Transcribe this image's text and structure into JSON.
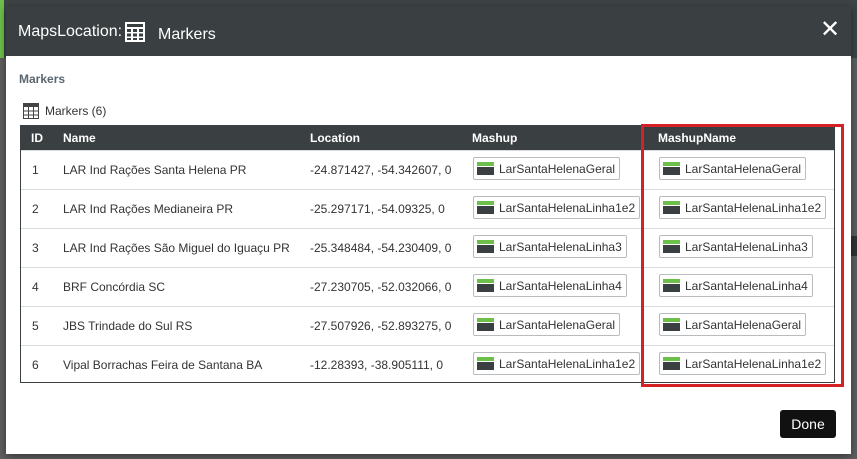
{
  "modal": {
    "title": "MapsLocation:",
    "subtitle": "Markers",
    "section_title": "Markers",
    "grid_caption": "Markers (6)",
    "done_label": "Done"
  },
  "grid": {
    "columns": [
      "ID",
      "Name",
      "Location",
      "Mashup",
      "MashupName"
    ],
    "rows": [
      {
        "id": "1",
        "name": "LAR Ind Rações Santa Helena PR",
        "location": "-24.871427, -54.342607, 0",
        "mashup": "LarSantaHelenaGeral",
        "mashup_name": "LarSantaHelenaGeral"
      },
      {
        "id": "2",
        "name": "LAR Ind Rações Medianeira PR",
        "location": "-25.297171, -54.09325, 0",
        "mashup": "LarSantaHelenaLinha1e2",
        "mashup_name": "LarSantaHelenaLinha1e2"
      },
      {
        "id": "3",
        "name": "LAR Ind Rações São Miguel do Iguaçu PR",
        "location": "-25.348484, -54.230409, 0",
        "mashup": "LarSantaHelenaLinha3",
        "mashup_name": "LarSantaHelenaLinha3"
      },
      {
        "id": "4",
        "name": "BRF Concórdia SC",
        "location": "-27.230705, -52.032066, 0",
        "mashup": "LarSantaHelenaLinha4",
        "mashup_name": "LarSantaHelenaLinha4"
      },
      {
        "id": "5",
        "name": "JBS Trindade do Sul RS",
        "location": "-27.507926, -52.893275, 0",
        "mashup": "LarSantaHelenaGeral",
        "mashup_name": "LarSantaHelenaGeral"
      },
      {
        "id": "6",
        "name": "Vipal Borrachas Feira de Santana BA",
        "location": "-12.28393, -38.905111, 0",
        "mashup": "LarSantaHelenaLinha1e2",
        "mashup_name": "LarSantaHelenaLinha1e2"
      }
    ]
  },
  "icons": {
    "header": "table-icon",
    "caption": "table-icon",
    "chip": "mashup-icon",
    "close": "close-icon"
  },
  "colors": {
    "header_bg": "#3a3f41",
    "accent_green": "#6cc04a",
    "highlight_red": "#d42126",
    "done_bg": "#111111"
  }
}
